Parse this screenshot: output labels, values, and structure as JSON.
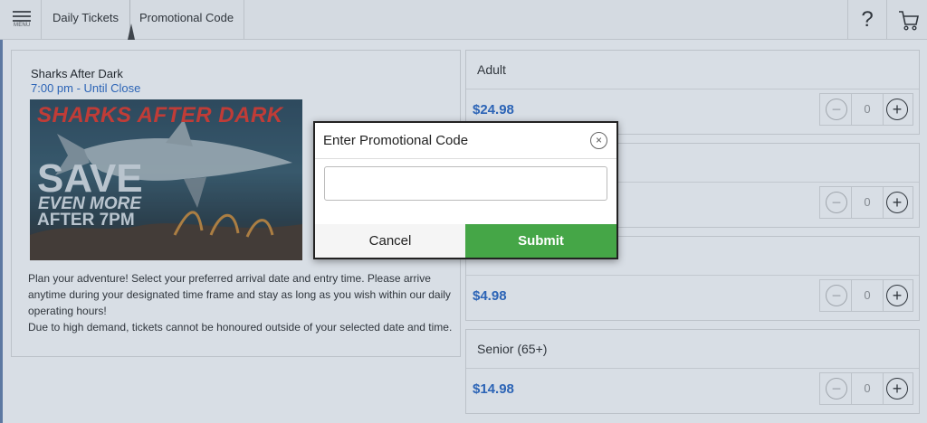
{
  "topbar": {
    "menu_label": "MENU",
    "tabs": [
      {
        "label": "Daily Tickets"
      },
      {
        "label": "Promotional Code"
      }
    ],
    "help_label": "?"
  },
  "event": {
    "title": "Sharks After Dark",
    "time": "7:00 pm - Until Close",
    "image": {
      "headline": "SHARKS AFTER DARK",
      "save": "SAVE",
      "even_more": "EVEN MORE",
      "after": "AFTER 7PM"
    },
    "description": [
      "Plan your adventure! Select your preferred arrival date and entry time. Please arrive anytime during your designated time frame and stay as long as you wish within our daily operating hours!",
      "Due to high demand, tickets cannot be honoured outside of your selected date and time."
    ]
  },
  "tickets": [
    {
      "name": "Adult",
      "price": "$24.98",
      "qty": "0"
    },
    {
      "name": "",
      "price": "",
      "qty": "0"
    },
    {
      "name": "",
      "price": "$4.98",
      "qty": "0"
    },
    {
      "name": "Senior (65+)",
      "price": "$14.98",
      "qty": "0"
    }
  ],
  "qty_controls": {
    "minus": "−",
    "plus": "+"
  },
  "modal": {
    "title": "Enter Promotional Code",
    "close_symbol": "×",
    "input_value": "",
    "input_placeholder": "",
    "cancel_label": "Cancel",
    "submit_label": "Submit"
  },
  "colors": {
    "price_blue": "#2e6bc6",
    "submit_green": "#45a647"
  }
}
